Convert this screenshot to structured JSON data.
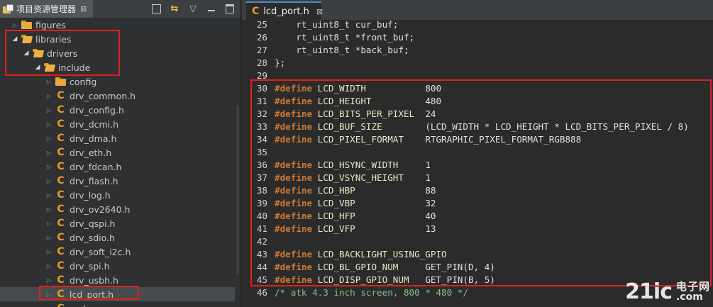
{
  "explorer": {
    "tab_title": "项目资源管理器",
    "tab_close": "⊠",
    "tools": {
      "collapse_all": "collapse",
      "link": "⇆",
      "menu": "▽",
      "minimize": "min",
      "maximize": "max"
    },
    "items": [
      {
        "label": "figures",
        "type": "folder",
        "expanded": false
      },
      {
        "label": "libraries",
        "type": "folder",
        "expanded": true
      },
      {
        "label": "drivers",
        "type": "folder",
        "expanded": true
      },
      {
        "label": "include",
        "type": "folder",
        "expanded": true
      },
      {
        "label": "config",
        "type": "folder",
        "expanded": false
      },
      {
        "label": "drv_common.h",
        "type": "file"
      },
      {
        "label": "drv_config.h",
        "type": "file"
      },
      {
        "label": "drv_dcmi.h",
        "type": "file"
      },
      {
        "label": "drv_dma.h",
        "type": "file"
      },
      {
        "label": "drv_eth.h",
        "type": "file"
      },
      {
        "label": "drv_fdcan.h",
        "type": "file"
      },
      {
        "label": "drv_flash.h",
        "type": "file"
      },
      {
        "label": "drv_log.h",
        "type": "file"
      },
      {
        "label": "drv_ov2640.h",
        "type": "file"
      },
      {
        "label": "drv_qspi.h",
        "type": "file"
      },
      {
        "label": "drv_sdio.h",
        "type": "file"
      },
      {
        "label": "drv_soft_i2c.h",
        "type": "file"
      },
      {
        "label": "drv_spi.h",
        "type": "file"
      },
      {
        "label": "drv_usbh.h",
        "type": "file"
      },
      {
        "label": "lcd_port.h",
        "type": "file",
        "selected": true
      },
      {
        "label": "pcd_...",
        "type": "file"
      }
    ]
  },
  "editor": {
    "tab_title": "lcd_port.h",
    "tab_close": "⊠",
    "file_icon": "C",
    "lines": [
      {
        "num": "25",
        "parts": [
          [
            "txt",
            "    rt_uint8_t cur_buf;"
          ]
        ]
      },
      {
        "num": "26",
        "parts": [
          [
            "txt",
            "    rt_uint8_t *front_buf;"
          ]
        ]
      },
      {
        "num": "27",
        "parts": [
          [
            "txt",
            "    rt_uint8_t *back_buf;"
          ]
        ]
      },
      {
        "num": "28",
        "parts": [
          [
            "txt",
            "};"
          ]
        ]
      },
      {
        "num": "29",
        "parts": []
      },
      {
        "num": "30",
        "parts": [
          [
            "kw",
            "#define"
          ],
          [
            "macro",
            " LCD_WIDTH           "
          ],
          [
            "val",
            "800"
          ]
        ]
      },
      {
        "num": "31",
        "parts": [
          [
            "kw",
            "#define"
          ],
          [
            "macro",
            " LCD_HEIGHT          "
          ],
          [
            "val",
            "480"
          ]
        ]
      },
      {
        "num": "32",
        "parts": [
          [
            "kw",
            "#define"
          ],
          [
            "macro",
            " LCD_BITS_PER_PIXEL  "
          ],
          [
            "val",
            "24"
          ]
        ]
      },
      {
        "num": "33",
        "parts": [
          [
            "kw",
            "#define"
          ],
          [
            "macro",
            " LCD_BUF_SIZE        "
          ],
          [
            "val",
            "(LCD_WIDTH * LCD_HEIGHT * LCD_BITS_PER_PIXEL / 8)"
          ]
        ]
      },
      {
        "num": "34",
        "parts": [
          [
            "kw",
            "#define"
          ],
          [
            "macro",
            " LCD_PIXEL_FORMAT    "
          ],
          [
            "val",
            "RTGRAPHIC_PIXEL_FORMAT_RGB888"
          ]
        ]
      },
      {
        "num": "35",
        "parts": []
      },
      {
        "num": "36",
        "parts": [
          [
            "kw",
            "#define"
          ],
          [
            "macro",
            " LCD_HSYNC_WIDTH     "
          ],
          [
            "val",
            "1"
          ]
        ]
      },
      {
        "num": "37",
        "parts": [
          [
            "kw",
            "#define"
          ],
          [
            "macro",
            " LCD_VSYNC_HEIGHT    "
          ],
          [
            "val",
            "1"
          ]
        ]
      },
      {
        "num": "38",
        "parts": [
          [
            "kw",
            "#define"
          ],
          [
            "macro",
            " LCD_HBP             "
          ],
          [
            "val",
            "88"
          ]
        ]
      },
      {
        "num": "39",
        "parts": [
          [
            "kw",
            "#define"
          ],
          [
            "macro",
            " LCD_VBP             "
          ],
          [
            "val",
            "32"
          ]
        ]
      },
      {
        "num": "40",
        "parts": [
          [
            "kw",
            "#define"
          ],
          [
            "macro",
            " LCD_HFP             "
          ],
          [
            "val",
            "40"
          ]
        ]
      },
      {
        "num": "41",
        "parts": [
          [
            "kw",
            "#define"
          ],
          [
            "macro",
            " LCD_VFP             "
          ],
          [
            "val",
            "13"
          ]
        ]
      },
      {
        "num": "42",
        "parts": []
      },
      {
        "num": "43",
        "parts": [
          [
            "kw",
            "#define"
          ],
          [
            "macro",
            " LCD_BACKLIGHT_USING_GPIO"
          ]
        ]
      },
      {
        "num": "44",
        "parts": [
          [
            "kw",
            "#define"
          ],
          [
            "macro",
            " LCD_BL_GPIO_NUM     "
          ],
          [
            "val",
            "GET_PIN(D, 4)"
          ]
        ]
      },
      {
        "num": "45",
        "parts": [
          [
            "kw",
            "#define"
          ],
          [
            "macro",
            " LCD_DISP_GPIO_NUM   "
          ],
          [
            "val",
            "GET_PIN(B, 5)"
          ]
        ]
      },
      {
        "num": "46",
        "parts": [
          [
            "cmt",
            "/* atk 4.3 inch screen, 800 * 480 */"
          ]
        ]
      }
    ]
  },
  "watermark": {
    "main": "21ic",
    "cn": "电子网",
    "com": ".com"
  },
  "colors": {
    "highlight_box": "#e0201a",
    "keyword": "#cc7832",
    "comment": "#7ec28d",
    "file_icon": "#e79c2a"
  }
}
